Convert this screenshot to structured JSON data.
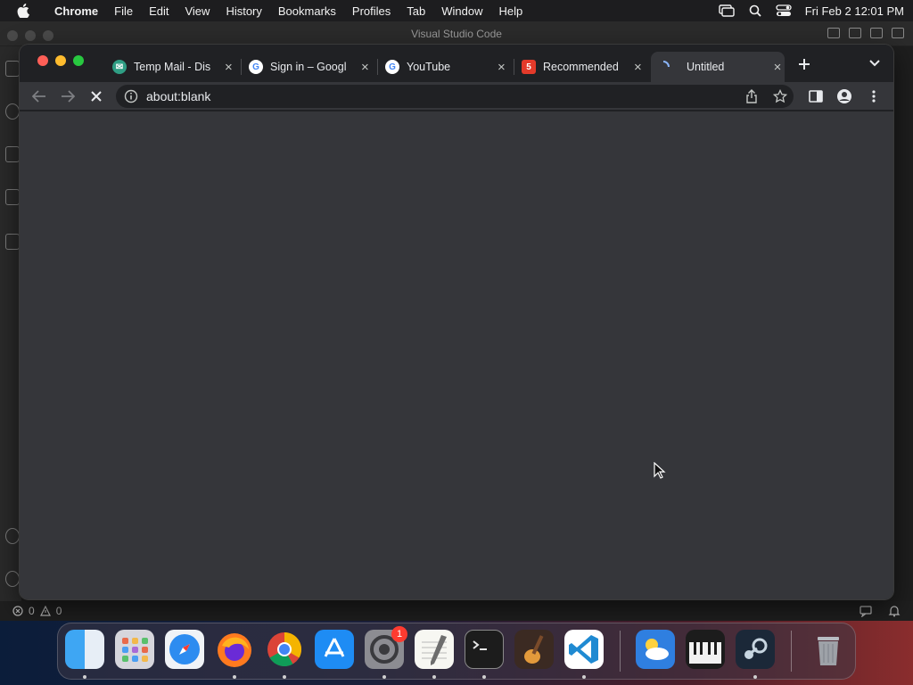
{
  "menubar": {
    "app_name": "Chrome",
    "items": [
      "File",
      "Edit",
      "View",
      "History",
      "Bookmarks",
      "Profiles",
      "Tab",
      "Window",
      "Help"
    ],
    "clock": "Fri Feb 2  12:01 PM"
  },
  "vscode": {
    "title": "Visual Studio Code",
    "status": {
      "errors": "0",
      "warnings": "0"
    }
  },
  "chrome": {
    "tabs": [
      {
        "title": "Temp Mail - Dis",
        "icon": "tempmail-icon"
      },
      {
        "title": "Sign in – Googl",
        "icon": "google-icon"
      },
      {
        "title": "YouTube",
        "icon": "google-icon"
      },
      {
        "title": "Recommended",
        "icon": "recommended-icon"
      },
      {
        "title": "Untitled",
        "icon": "loading-spinner-icon"
      }
    ],
    "active_tab_index": 4,
    "address": {
      "url": "about:blank"
    }
  },
  "dock": {
    "apps": [
      {
        "name": "Finder",
        "icon": "finder-icon"
      },
      {
        "name": "Launchpad",
        "icon": "launchpad-icon"
      },
      {
        "name": "Safari",
        "icon": "safari-icon"
      },
      {
        "name": "Firefox",
        "icon": "firefox-icon"
      },
      {
        "name": "Chrome",
        "icon": "chrome-icon"
      },
      {
        "name": "App Store",
        "icon": "app-store-icon"
      },
      {
        "name": "System Settings",
        "icon": "settings-icon",
        "badge": "1"
      },
      {
        "name": "TextEdit",
        "icon": "textedit-icon"
      },
      {
        "name": "Terminal",
        "icon": "terminal-icon"
      },
      {
        "name": "GarageBand",
        "icon": "garageband-icon"
      },
      {
        "name": "Visual Studio Code",
        "icon": "vscode-icon"
      },
      {
        "name": "Weather",
        "icon": "weather-icon"
      },
      {
        "name": "Piano",
        "icon": "piano-icon"
      },
      {
        "name": "Steam",
        "icon": "steam-icon"
      },
      {
        "name": "Trash",
        "icon": "trash-icon"
      }
    ]
  }
}
